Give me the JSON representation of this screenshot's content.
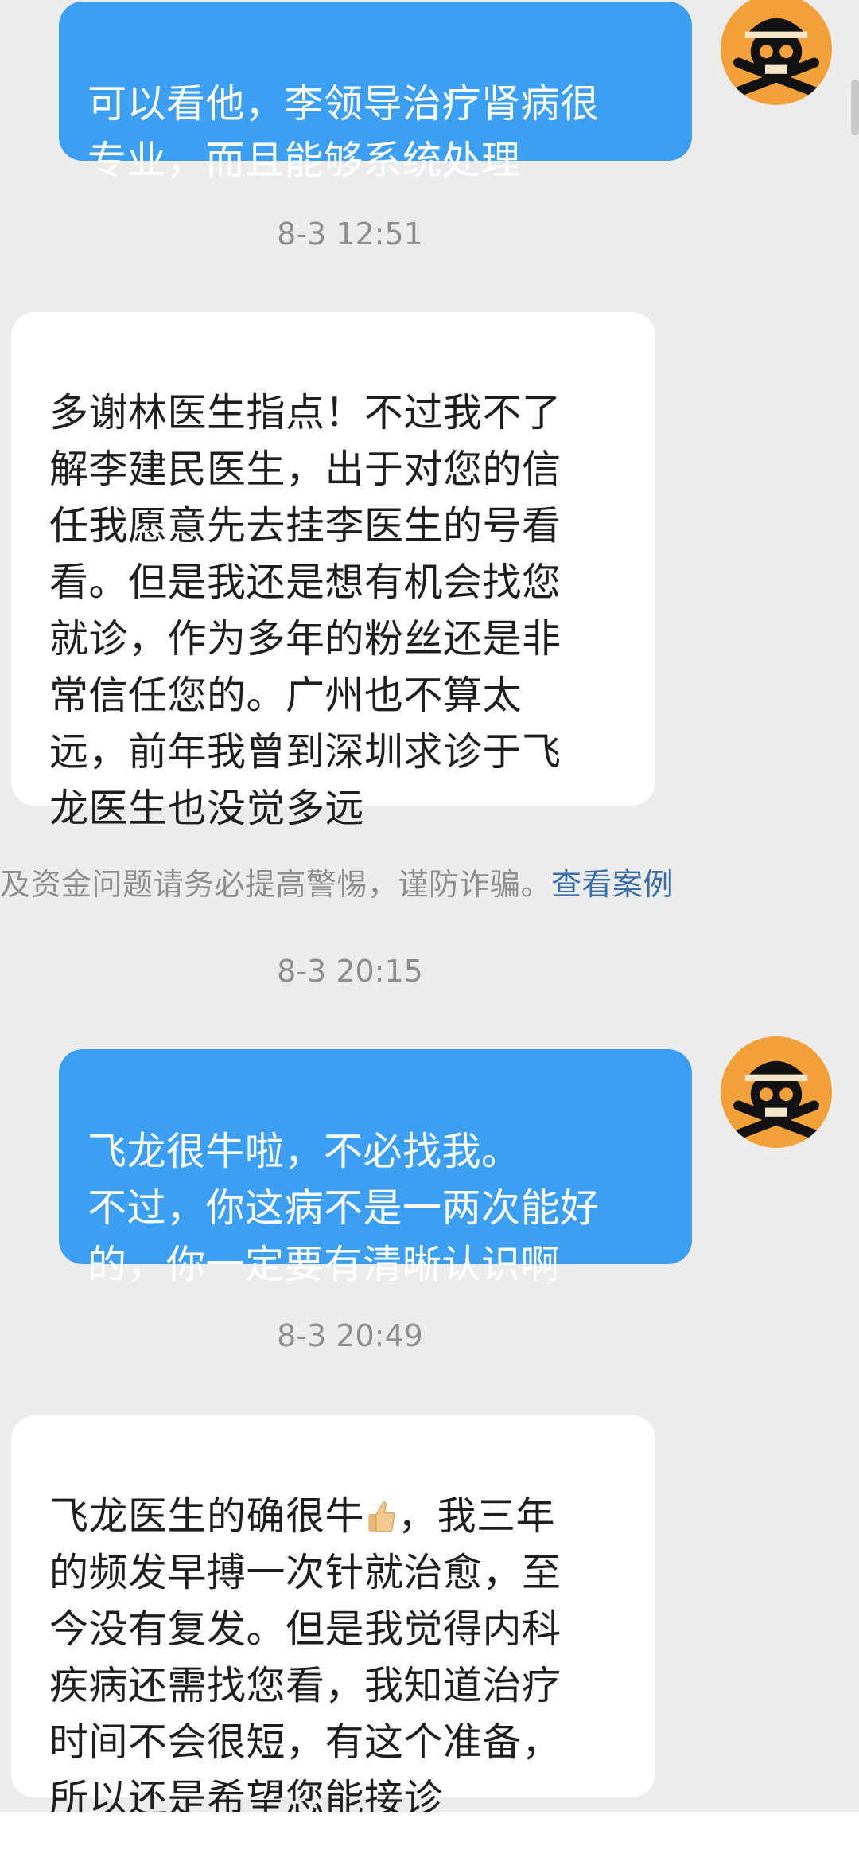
{
  "messages": [
    {
      "direction": "outgoing",
      "text": "可以看他，李领导治疗肾病很\n专业，而且能够系统处理"
    },
    {
      "direction": "incoming",
      "text": "多谢林医生指点！不过我不了\n解李建民医生，出于对您的信\n任我愿意先去挂李医生的号看\n看。但是我还是想有机会找您\n就诊，作为多年的粉丝还是非\n常信任您的。广州也不算太\n远，前年我曾到深圳求诊于飞\n龙医生也没觉多远"
    },
    {
      "direction": "outgoing",
      "text": "飞龙很牛啦，不必找我。\n不过，你这病不是一两次能好\n的，你一定要有清晰认识啊"
    },
    {
      "direction": "incoming",
      "text_before_emoji": "飞龙医生的确很牛",
      "emoji": "thumbs-up-icon",
      "text_after_emoji": "，我三年\n的频发早搏一次针就治愈，至\n今没有复发。但是我觉得内科\n疾病还需找您看，我知道治疗\n时间不会很短，有这个准备，\n所以还是希望您能接诊"
    }
  ],
  "timestamps": [
    "8-3 12:51",
    "8-3 20:15",
    "8-3 20:49"
  ],
  "notice": {
    "text": "及资金问题请务必提高警惕，谨防诈骗。",
    "link": "查看案例"
  },
  "avatar_icon": "pirate-skull-avatar-icon",
  "colors": {
    "background": "#ececec",
    "outgoing_bubble": "#3d9ff2",
    "incoming_bubble": "#ffffff",
    "link": "#3a6fa5"
  }
}
